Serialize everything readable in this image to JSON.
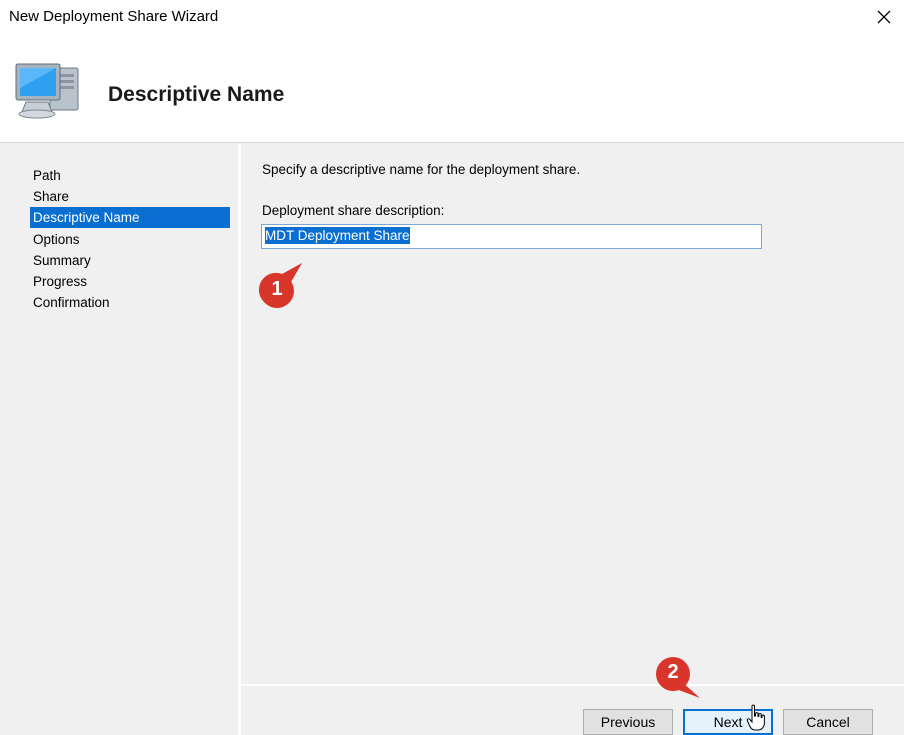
{
  "window": {
    "title": "New Deployment Share Wizard"
  },
  "header": {
    "title": "Descriptive Name"
  },
  "nav": {
    "items": [
      {
        "label": "Path"
      },
      {
        "label": "Share"
      },
      {
        "label": "Descriptive Name"
      },
      {
        "label": "Options"
      },
      {
        "label": "Summary"
      },
      {
        "label": "Progress"
      },
      {
        "label": "Confirmation"
      }
    ],
    "active_index": 2
  },
  "content": {
    "instruction": "Specify a descriptive name for the deployment share.",
    "field_label": "Deployment share description:",
    "field_value": "MDT Deployment Share"
  },
  "buttons": {
    "previous": "Previous",
    "next": "Next",
    "cancel": "Cancel"
  },
  "markers": {
    "one": "1",
    "two": "2"
  },
  "colors": {
    "accent": "#0a6fd1",
    "marker": "#d9362b"
  },
  "icons": {
    "header": "computer-monitor-icon",
    "close": "close-icon",
    "cursor": "hand-pointer-icon"
  }
}
